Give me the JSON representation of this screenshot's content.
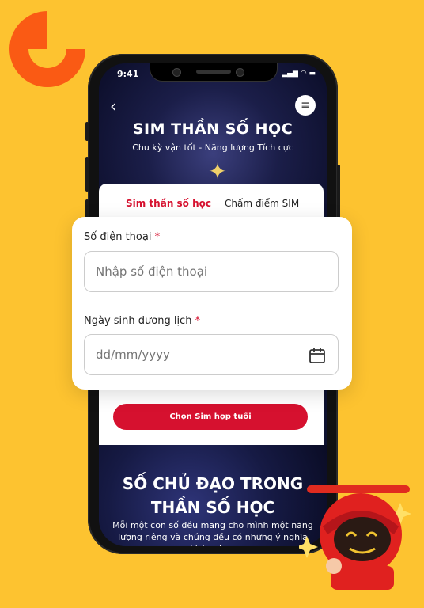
{
  "brand": {
    "accent": "#d6112f",
    "logo_color": "#FA5A14",
    "background": "#FDC330"
  },
  "status_bar": {
    "time": "9:41"
  },
  "header": {
    "title": "SIM THẦN SỐ HỌC",
    "subtitle": "Chu kỳ vận tốt - Năng lượng Tích cực"
  },
  "tabs": [
    {
      "label": "Sim thần số học",
      "active": true
    },
    {
      "label": "Chấm điểm SIM",
      "active": false
    }
  ],
  "form": {
    "phone": {
      "label": "Số điện thoại",
      "required_mark": "*",
      "placeholder": "Nhập số điện thoại"
    },
    "birthdate": {
      "label": "Ngày sinh dương lịch",
      "required_mark": "*",
      "placeholder": "dd/mm/yyyy",
      "icon": "calendar-icon"
    }
  },
  "cta": {
    "label": "Chọn Sim hợp tuổi"
  },
  "lower": {
    "title_line1": "SỐ CHỦ ĐẠO TRONG",
    "title_line2": "THẦN SỐ HỌC",
    "description": "Mỗi một con số đều mang cho mình một năng lượng riêng và chúng đều có những ý nghĩa khác nhau"
  }
}
